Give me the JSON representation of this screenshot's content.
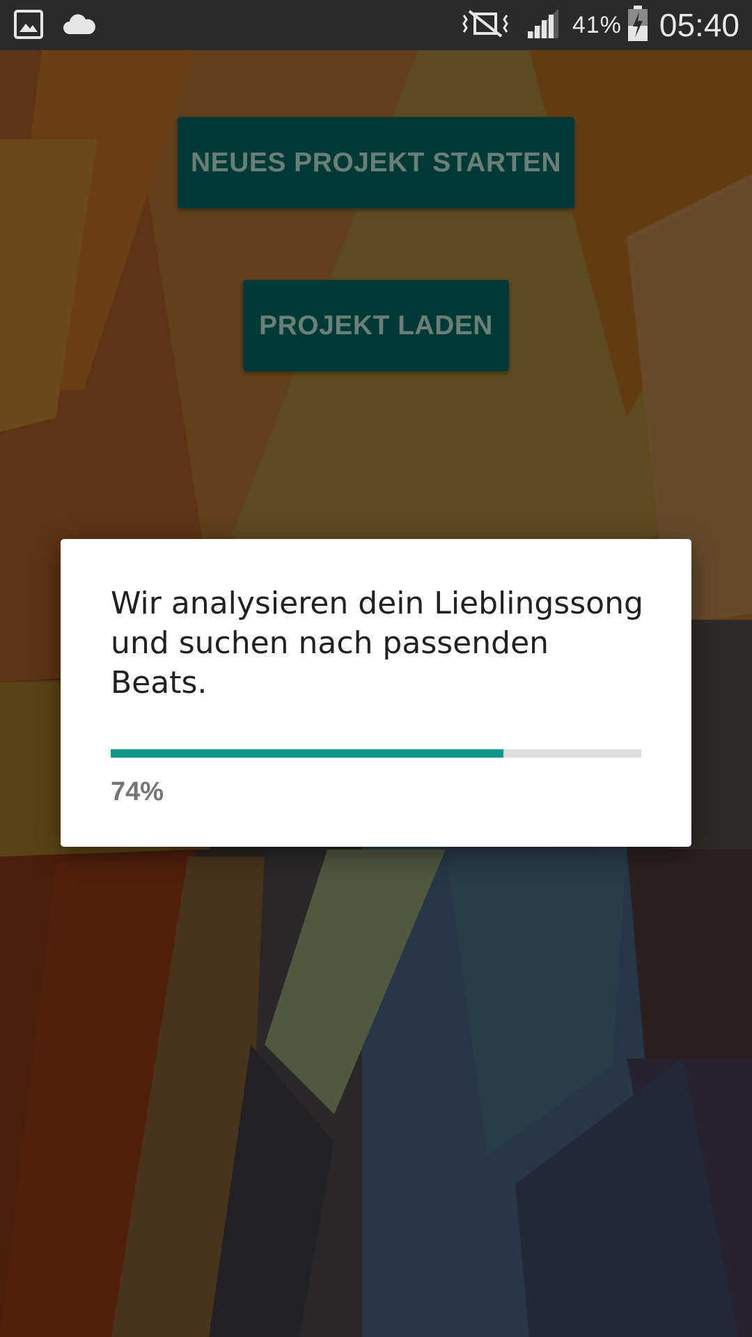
{
  "status_bar": {
    "icons_left": [
      "image-icon",
      "cloud-icon"
    ],
    "icons_right": [
      "vibrate-mute-icon",
      "signal-icon",
      "battery-charging-icon"
    ],
    "battery": "41%",
    "time": "05:40"
  },
  "main": {
    "new_project_label": "NEUES PROJEKT STARTEN",
    "load_project_label": "PROJEKT LADEN"
  },
  "dialog": {
    "message": "Wir analysieren dein Lieblingssong und suchen nach passenden Beats.",
    "progress_value": 0.74,
    "progress_label": "74%"
  },
  "colors": {
    "button_bg": "#003a34",
    "button_text": "#6a7f78",
    "progress_fill": "#129688",
    "progress_track": "#dcdcdc",
    "status_bar_bg": "#2a2a2a"
  }
}
